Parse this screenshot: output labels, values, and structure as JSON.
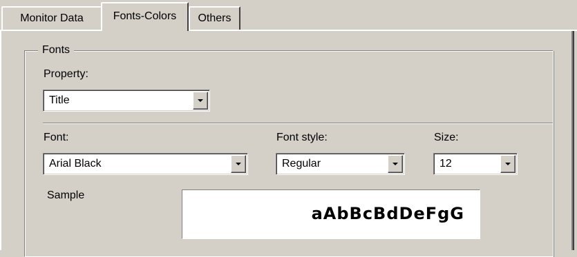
{
  "tabs": [
    {
      "label": "Monitor Data",
      "active": false
    },
    {
      "label": "Fonts-Colors",
      "active": true
    },
    {
      "label": "Others",
      "active": false
    }
  ],
  "fonts_group": {
    "title": "Fonts",
    "property": {
      "label": "Property:",
      "value": "Title"
    },
    "font": {
      "label": "Font:",
      "value": "Arial Black"
    },
    "font_style": {
      "label": "Font style:",
      "value": "Regular"
    },
    "size": {
      "label": "Size:",
      "value": "12"
    },
    "sample": {
      "label": "Sample",
      "text": "aAbBcBdDeFgG"
    }
  },
  "colors": {
    "face": "#d4d0c8",
    "highlight": "#ffffff",
    "shadow": "#808080",
    "dark_shadow": "#404040",
    "field": "#ffffff"
  }
}
